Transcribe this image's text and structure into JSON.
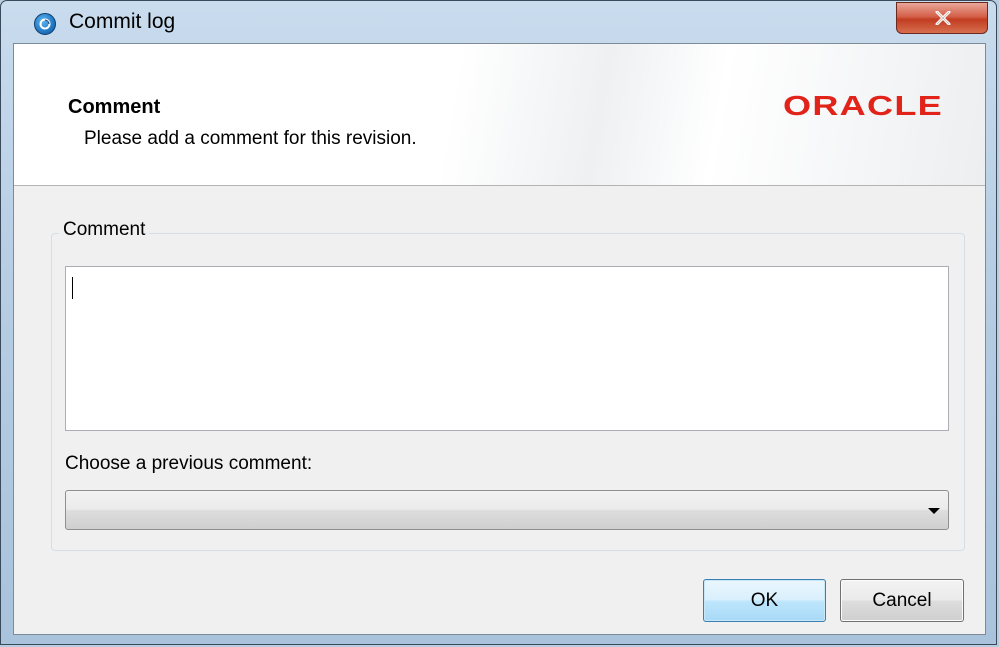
{
  "window": {
    "title": "Commit log"
  },
  "header": {
    "title": "Comment",
    "subtitle": "Please add a comment for this revision.",
    "logo_text": "ORACLE"
  },
  "comment_group": {
    "legend": "Comment",
    "comment_value": "",
    "previous_label": "Choose a previous comment:",
    "previous_selected": ""
  },
  "buttons": {
    "ok_label": "OK",
    "cancel_label": "Cancel"
  },
  "colors": {
    "logo_red": "#e2231a",
    "close_red": "#c94a33",
    "ok_border": "#3c7fb1"
  }
}
